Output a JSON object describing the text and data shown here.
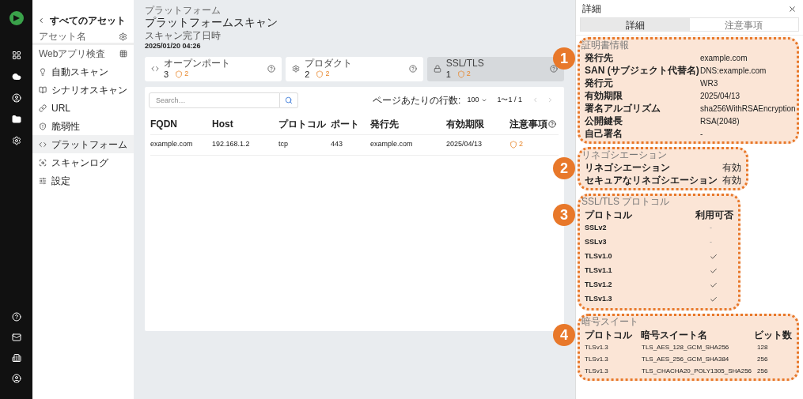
{
  "nav": {
    "back_label": "すべてのアセット",
    "asset_label": "アセット名",
    "group_label": "Webアプリ検査",
    "items": [
      {
        "label": "自動スキャン",
        "selected": false
      },
      {
        "label": "シナリオスキャン",
        "selected": false
      },
      {
        "label": "URL",
        "selected": false
      },
      {
        "label": "脆弱性",
        "selected": false
      },
      {
        "label": "プラットフォーム",
        "selected": true
      },
      {
        "label": "スキャンログ",
        "selected": false
      },
      {
        "label": "設定",
        "selected": false
      }
    ]
  },
  "main": {
    "breadcrumb": "プラットフォーム",
    "title": "プラットフォームスキャン",
    "scan_label": "スキャン完了日時",
    "scan_time": "2025/01/20 04:26",
    "cards": [
      {
        "label": "オープンポート",
        "count": "3",
        "warnings": "2",
        "selected": false
      },
      {
        "label": "プロダクト",
        "count": "2",
        "warnings": "2",
        "selected": false
      },
      {
        "label": "SSL/TLS",
        "count": "1",
        "warnings": "2",
        "selected": true
      }
    ],
    "table": {
      "search_placeholder": "Search…",
      "rows_per_page_label": "ページあたりの行数:",
      "rows_per_page": "100",
      "range": "1〜1 / 1",
      "columns": [
        "FQDN",
        "Host",
        "プロトコル",
        "ポート",
        "発行先",
        "有効期限",
        "注意事項"
      ],
      "rows": [
        {
          "cells": [
            "example.com",
            "192.168.1.2",
            "tcp",
            "443",
            "example.com",
            "2025/04/13"
          ],
          "warnings": "2"
        }
      ]
    }
  },
  "detail": {
    "title": "詳細",
    "tabs": [
      {
        "label": "詳細",
        "selected": true
      },
      {
        "label": "注意事項",
        "selected": false
      }
    ],
    "certificate": {
      "callout": "1",
      "title": "証明書情報",
      "rows": [
        {
          "label": "発行先",
          "value": "example.com"
        },
        {
          "label": "SAN (サブジェクト代替名)",
          "value": "DNS:example.com"
        },
        {
          "label": "発行元",
          "value": "WR3"
        },
        {
          "label": "有効期限",
          "value": "2025/04/13"
        },
        {
          "label": "署名アルゴリズム",
          "value": "sha256WithRSAEncryption"
        },
        {
          "label": "公開鍵長",
          "value": "RSA(2048)"
        },
        {
          "label": "自己署名",
          "value": "-"
        }
      ]
    },
    "renegotiation": {
      "callout": "2",
      "title": "リネゴシエーション",
      "rows": [
        {
          "label": "リネゴシエーション",
          "value": "有効"
        },
        {
          "label": "セキュアなリネゴシエーション",
          "value": "有効"
        }
      ]
    },
    "protocols": {
      "callout": "3",
      "title": "SSL/TLS プロトコル",
      "columns": [
        "プロトコル",
        "利用可否"
      ],
      "rows": [
        {
          "protocol": "SSLv2",
          "available": false,
          "text": "-"
        },
        {
          "protocol": "SSLv3",
          "available": false,
          "text": "-"
        },
        {
          "protocol": "TLSv1.0",
          "available": true
        },
        {
          "protocol": "TLSv1.1",
          "available": true
        },
        {
          "protocol": "TLSv1.2",
          "available": true
        },
        {
          "protocol": "TLSv1.3",
          "available": true
        }
      ]
    },
    "ciphers": {
      "callout": "4",
      "title": "暗号スイート",
      "columns": [
        "プロトコル",
        "暗号スイート名",
        "ビット数"
      ],
      "rows": [
        [
          "TLSv1.3",
          "TLS_AES_128_GCM_SHA256",
          "128"
        ],
        [
          "TLSv1.3",
          "TLS_AES_256_GCM_SHA384",
          "256"
        ],
        [
          "TLSv1.3",
          "TLS_CHACHA20_POLY1305_SHA256",
          "256"
        ]
      ]
    }
  }
}
